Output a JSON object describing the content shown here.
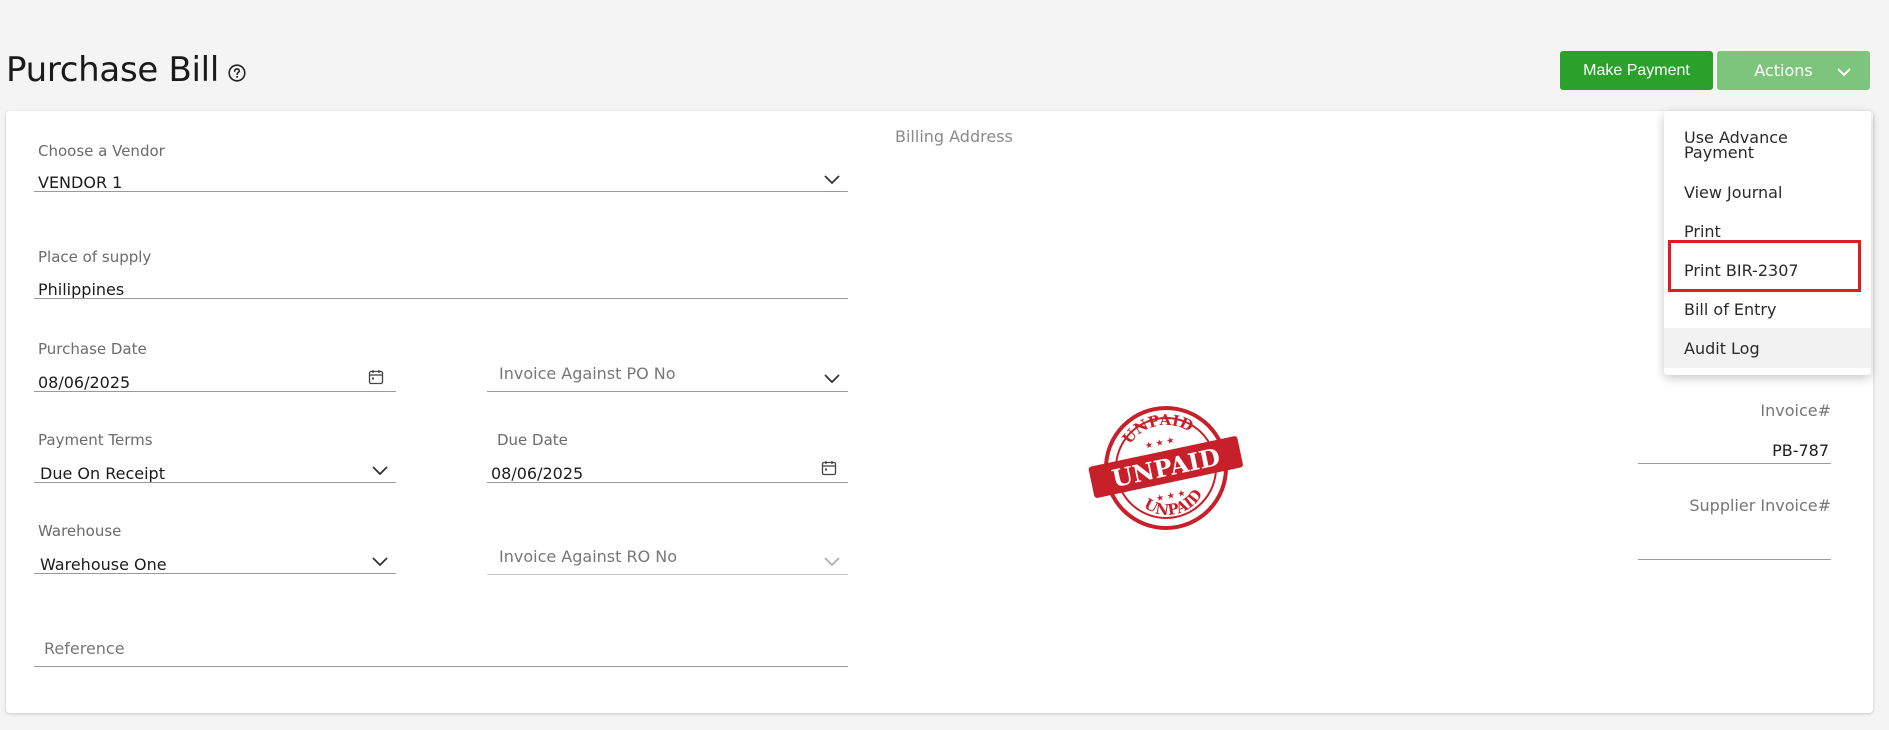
{
  "page": {
    "title": "Purchase Bill"
  },
  "header": {
    "make_payment_label": "Make Payment",
    "actions_label": "Actions"
  },
  "actions_menu": {
    "items": [
      {
        "label": "Use Advance Payment"
      },
      {
        "label": "View Journal"
      },
      {
        "label": "Print"
      },
      {
        "label": "Print BIR-2307"
      },
      {
        "label": "Bill of Entry"
      },
      {
        "label": "Audit Log"
      }
    ]
  },
  "form": {
    "vendor": {
      "label": "Choose a Vendor",
      "value": "VENDOR 1"
    },
    "place_of_supply": {
      "label": "Place of supply",
      "value": "Philippines"
    },
    "purchase_date": {
      "label": "Purchase Date",
      "value": "08/06/2025"
    },
    "invoice_against_po": {
      "placeholder": "Invoice Against PO No"
    },
    "payment_terms": {
      "label": "Payment Terms",
      "value": "Due On Receipt"
    },
    "due_date": {
      "label": "Due Date",
      "value": "08/06/2025"
    },
    "warehouse": {
      "label": "Warehouse",
      "value": "Warehouse One"
    },
    "invoice_against_ro": {
      "placeholder": "Invoice Against RO No"
    },
    "reference": {
      "placeholder": "Reference"
    }
  },
  "billing": {
    "label": "Billing Address"
  },
  "invoice": {
    "label": "Invoice#",
    "value": "PB-787"
  },
  "supplier_invoice": {
    "label": "Supplier Invoice#",
    "value": ""
  },
  "stamp": {
    "top_text": "UNPAID",
    "center_text": "UNPAID",
    "bottom_text": "UNPAID",
    "color": "#c8202a"
  },
  "colors": {
    "primary_green": "#2aa12a",
    "light_green": "#7dc47d",
    "highlight": "#e01b24"
  }
}
